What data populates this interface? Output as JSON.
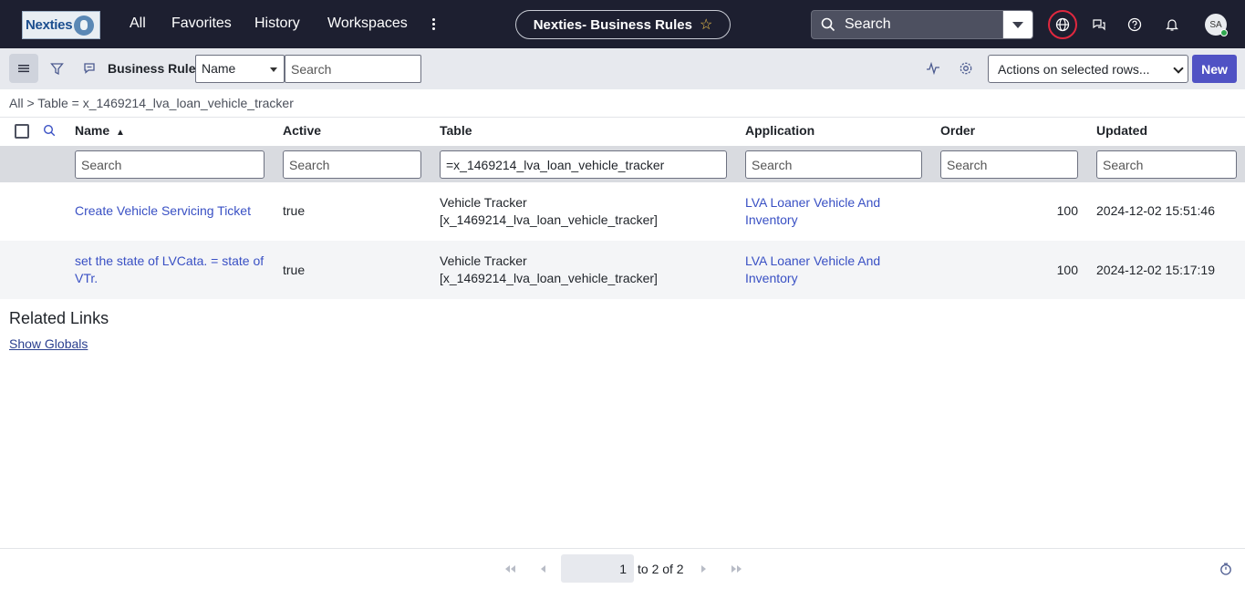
{
  "header": {
    "logo_text": "Nexties",
    "nav": [
      "All",
      "Favorites",
      "History",
      "Workspaces"
    ],
    "page_title": "Nexties- Business Rules",
    "search_label": "Search",
    "avatar_initials": "SA"
  },
  "toolbar": {
    "title": "Business Rules",
    "field_select": "Name",
    "search_placeholder": "Search",
    "actions_select": "Actions on selected rows...",
    "new_label": "New"
  },
  "breadcrumb": {
    "all": "All",
    "sep": ">",
    "filter": "Table = x_1469214_lva_loan_vehicle_tracker"
  },
  "table": {
    "columns": [
      "Name",
      "Active",
      "Table",
      "Application",
      "Order",
      "Updated"
    ],
    "sort_indicator": "▲",
    "filters": {
      "name": "Search",
      "active": "Search",
      "table": "=x_1469214_lva_loan_vehicle_tracker",
      "application": "Search",
      "order": "Search",
      "updated": "Search"
    },
    "rows": [
      {
        "name": "Create Vehicle Servicing Ticket",
        "name_line2": "",
        "active": "true",
        "table_line1": "Vehicle Tracker",
        "table_line2": "[x_1469214_lva_loan_vehicle_tracker]",
        "app_line1": "LVA Loaner Vehicle And",
        "app_line2": "Inventory",
        "order": "100",
        "updated": "2024-12-02 15:51:46"
      },
      {
        "name": "set the state of LVCata. = state of",
        "name_line2": "VTr.",
        "active": "true",
        "table_line1": "Vehicle Tracker",
        "table_line2": "[x_1469214_lva_loan_vehicle_tracker]",
        "app_line1": "LVA Loaner Vehicle And",
        "app_line2": "Inventory",
        "order": "100",
        "updated": "2024-12-02 15:17:19"
      }
    ]
  },
  "related": {
    "heading": "Related Links",
    "link": "Show Globals"
  },
  "pagination": {
    "current": "1",
    "summary": "to 2 of 2"
  },
  "colors": {
    "topbar": "#1d1f30",
    "accent": "#5052c4",
    "link": "#3950c4",
    "highlight_ring": "#e0283f"
  }
}
